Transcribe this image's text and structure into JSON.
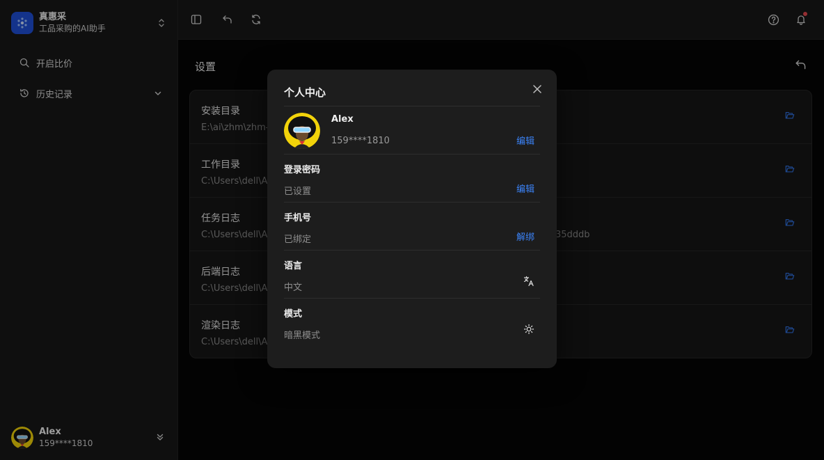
{
  "sidebar": {
    "brand_name": "真惠采",
    "brand_subtitle": "工品采购的AI助手",
    "nav": [
      {
        "label": "开启比价",
        "icon": "search-icon"
      },
      {
        "label": "历史记录",
        "icon": "history-icon"
      }
    ],
    "user": {
      "name": "Alex",
      "phone": "159****1810"
    }
  },
  "topbar": {
    "icons": [
      "sidebar-toggle-icon",
      "undo-icon",
      "refresh-icon",
      "help-icon",
      "bell-icon"
    ],
    "has_notification": true
  },
  "main": {
    "title": "设置",
    "settings": [
      {
        "label": "安装目录",
        "path": "E:\\ai\\zhm\\zhm-",
        "suffix": ""
      },
      {
        "label": "工作目录",
        "path": "C:\\Users\\dell\\Ap",
        "suffix": ""
      },
      {
        "label": "任务日志",
        "path": "C:\\Users\\dell\\Ap",
        "suffix": "35dddb"
      },
      {
        "label": "后端日志",
        "path": "C:\\Users\\dell\\Ap",
        "suffix": ""
      },
      {
        "label": "渲染日志",
        "path": "C:\\Users\\dell\\Ap",
        "suffix": ""
      }
    ]
  },
  "modal": {
    "title": "个人中心",
    "profile": {
      "name": "Alex",
      "phone": "159****1810",
      "action": "编辑"
    },
    "rows": [
      {
        "title": "登录密码",
        "value": "已设置",
        "action": "编辑",
        "icon": ""
      },
      {
        "title": "手机号",
        "value": "已绑定",
        "action": "解绑",
        "icon": ""
      },
      {
        "title": "语言",
        "value": "中文",
        "action": "",
        "icon": "translate-icon"
      },
      {
        "title": "模式",
        "value": "暗黑模式",
        "action": "",
        "icon": "sun-icon"
      }
    ]
  },
  "colors": {
    "accent": "#3b82f6",
    "brand": "#1f4fd6",
    "notify": "#e5484d"
  }
}
